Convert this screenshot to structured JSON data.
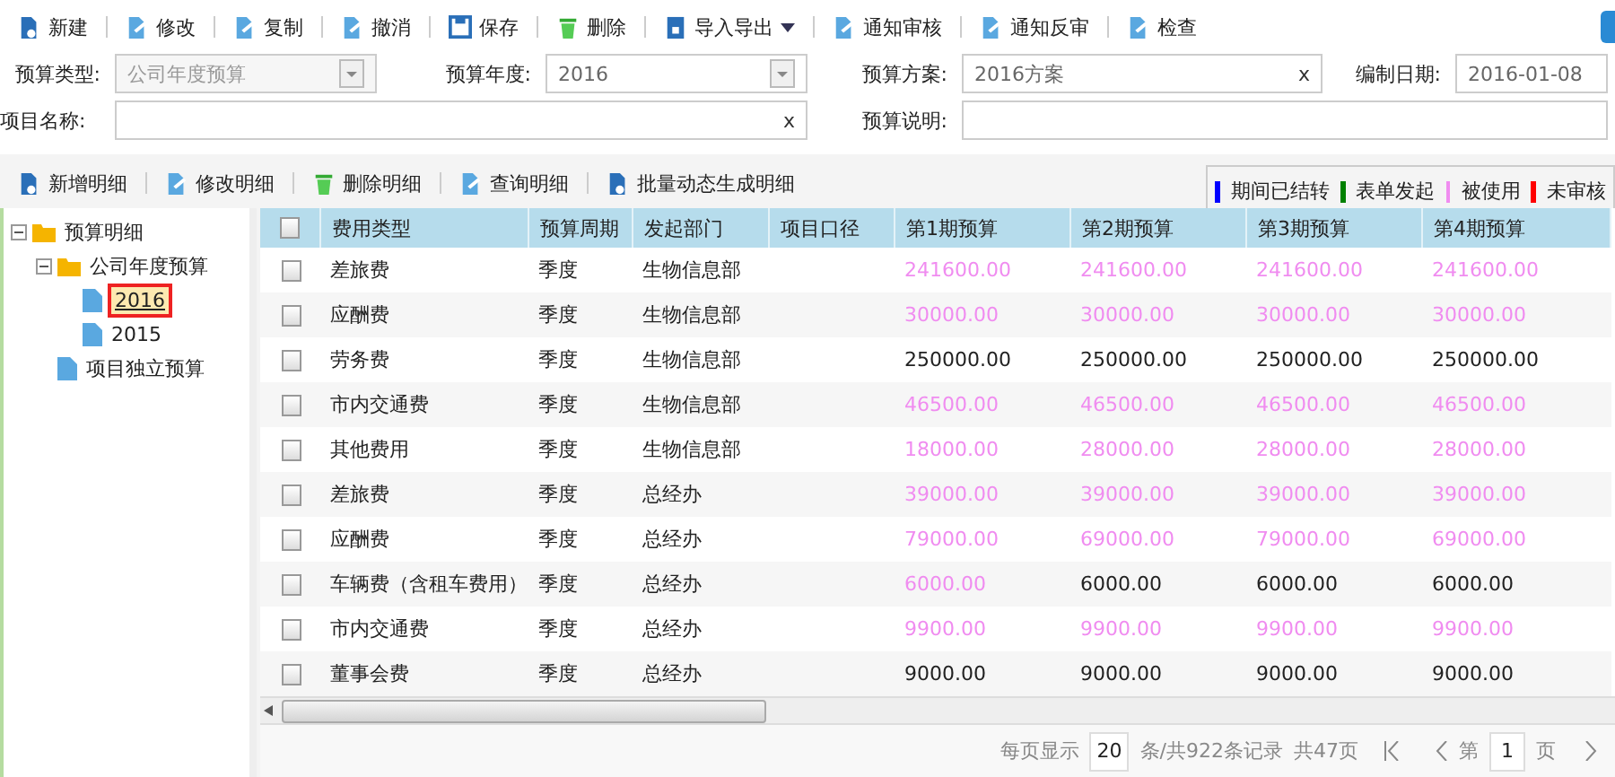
{
  "toolbar": [
    {
      "kind": "new",
      "label": "新建"
    },
    {
      "kind": "edit",
      "label": "修改"
    },
    {
      "kind": "edit",
      "label": "复制"
    },
    {
      "kind": "edit",
      "label": "撤消"
    },
    {
      "kind": "save",
      "label": "保存"
    },
    {
      "kind": "delete",
      "label": "删除"
    },
    {
      "kind": "import",
      "label": "导入导出",
      "dropdown": true
    },
    {
      "kind": "edit",
      "label": "通知审核"
    },
    {
      "kind": "edit",
      "label": "通知反审"
    },
    {
      "kind": "edit",
      "label": "检查"
    }
  ],
  "form": {
    "fields": [
      {
        "label": "预算类型:",
        "kind": "select",
        "value": "公司年度预算",
        "disabled": true
      },
      {
        "label": "预算年度:",
        "kind": "select",
        "value": "2016",
        "disabled": false
      },
      {
        "label": "预算方案:",
        "kind": "clearable",
        "value": "2016方案",
        "clear": "x"
      },
      {
        "label": "编制日期:",
        "kind": "text",
        "value": "2016-01-08"
      },
      {
        "label": "项目名称:",
        "kind": "clearable",
        "clear": "x"
      },
      {
        "label": "预算说明:",
        "kind": "text"
      }
    ]
  },
  "detail_toolbar": [
    {
      "kind": "new",
      "label": "新增明细"
    },
    {
      "kind": "edit",
      "label": "修改明细"
    },
    {
      "kind": "delete",
      "label": "删除明细"
    },
    {
      "kind": "edit",
      "label": "查询明细"
    },
    {
      "kind": "new",
      "label": "批量动态生成明细"
    }
  ],
  "legend": [
    {
      "color": "#0000ff",
      "label": "期间已结转"
    },
    {
      "color": "#008000",
      "label": "表单发起"
    },
    {
      "color": "#f08cf0",
      "label": "被使用"
    },
    {
      "color": "#ff0000",
      "label": "未审核"
    }
  ],
  "tree": [
    {
      "label": "预算明细",
      "kind": "folder",
      "expanded": true,
      "selected": false,
      "children": [
        {
          "label": "公司年度预算",
          "kind": "folder",
          "expanded": true,
          "selected": false,
          "children": [
            {
              "label": "2016",
              "kind": "file",
              "selected": true
            },
            {
              "label": "2015",
              "kind": "file",
              "selected": false
            }
          ]
        },
        {
          "label": "项目独立预算",
          "kind": "file",
          "selected": false
        }
      ]
    }
  ],
  "table": {
    "all_checked": false,
    "columns": [
      "费用类型",
      "预算周期",
      "发起部门",
      "项目口径",
      "第1期预算",
      "第2期预算",
      "第3期预算",
      "第4期预算"
    ],
    "rows": [
      {
        "checked": false,
        "cells": [
          "差旅费",
          "季度",
          "生物信息部"
        ],
        "periods": [
          {
            "value": "241600.00",
            "used": true
          },
          {
            "value": "241600.00",
            "used": true
          },
          {
            "value": "241600.00",
            "used": true
          },
          {
            "value": "241600.00",
            "used": true
          }
        ]
      },
      {
        "checked": false,
        "cells": [
          "应酬费",
          "季度",
          "生物信息部"
        ],
        "periods": [
          {
            "value": "30000.00",
            "used": true
          },
          {
            "value": "30000.00",
            "used": true
          },
          {
            "value": "30000.00",
            "used": true
          },
          {
            "value": "30000.00",
            "used": true
          }
        ]
      },
      {
        "checked": false,
        "cells": [
          "劳务费",
          "季度",
          "生物信息部"
        ],
        "periods": [
          {
            "value": "250000.00",
            "used": false
          },
          {
            "value": "250000.00",
            "used": false
          },
          {
            "value": "250000.00",
            "used": false
          },
          {
            "value": "250000.00",
            "used": false
          }
        ]
      },
      {
        "checked": false,
        "cells": [
          "市内交通费",
          "季度",
          "生物信息部"
        ],
        "periods": [
          {
            "value": "46500.00",
            "used": true
          },
          {
            "value": "46500.00",
            "used": true
          },
          {
            "value": "46500.00",
            "used": true
          },
          {
            "value": "46500.00",
            "used": true
          }
        ]
      },
      {
        "checked": false,
        "cells": [
          "其他费用",
          "季度",
          "生物信息部"
        ],
        "periods": [
          {
            "value": "18000.00",
            "used": true
          },
          {
            "value": "28000.00",
            "used": true
          },
          {
            "value": "28000.00",
            "used": true
          },
          {
            "value": "28000.00",
            "used": true
          }
        ]
      },
      {
        "checked": false,
        "cells": [
          "差旅费",
          "季度",
          "总经办"
        ],
        "periods": [
          {
            "value": "39000.00",
            "used": true
          },
          {
            "value": "39000.00",
            "used": true
          },
          {
            "value": "39000.00",
            "used": true
          },
          {
            "value": "39000.00",
            "used": true
          }
        ]
      },
      {
        "checked": false,
        "cells": [
          "应酬费",
          "季度",
          "总经办"
        ],
        "periods": [
          {
            "value": "79000.00",
            "used": true
          },
          {
            "value": "69000.00",
            "used": true
          },
          {
            "value": "79000.00",
            "used": true
          },
          {
            "value": "69000.00",
            "used": true
          }
        ]
      },
      {
        "checked": false,
        "cells": [
          "车辆费（含租车费用）",
          "季度",
          "总经办"
        ],
        "periods": [
          {
            "value": "6000.00",
            "used": true
          },
          {
            "value": "6000.00",
            "used": false
          },
          {
            "value": "6000.00",
            "used": false
          },
          {
            "value": "6000.00",
            "used": false
          }
        ]
      },
      {
        "checked": false,
        "cells": [
          "市内交通费",
          "季度",
          "总经办"
        ],
        "periods": [
          {
            "value": "9900.00",
            "used": true
          },
          {
            "value": "9900.00",
            "used": true
          },
          {
            "value": "9900.00",
            "used": true
          },
          {
            "value": "9900.00",
            "used": true
          }
        ]
      },
      {
        "checked": false,
        "cells": [
          "董事会费",
          "季度",
          "总经办"
        ],
        "periods": [
          {
            "value": "9000.00",
            "used": false
          },
          {
            "value": "9000.00",
            "used": false
          },
          {
            "value": "9000.00",
            "used": false
          },
          {
            "value": "9000.00",
            "used": false
          }
        ]
      }
    ]
  },
  "pager": {
    "per_page_label": "每页显示",
    "per_page": "20",
    "records": "条/共922条记录",
    "pages": "共47页",
    "page_prefix": "第",
    "page": "1",
    "page_suffix": "页"
  }
}
